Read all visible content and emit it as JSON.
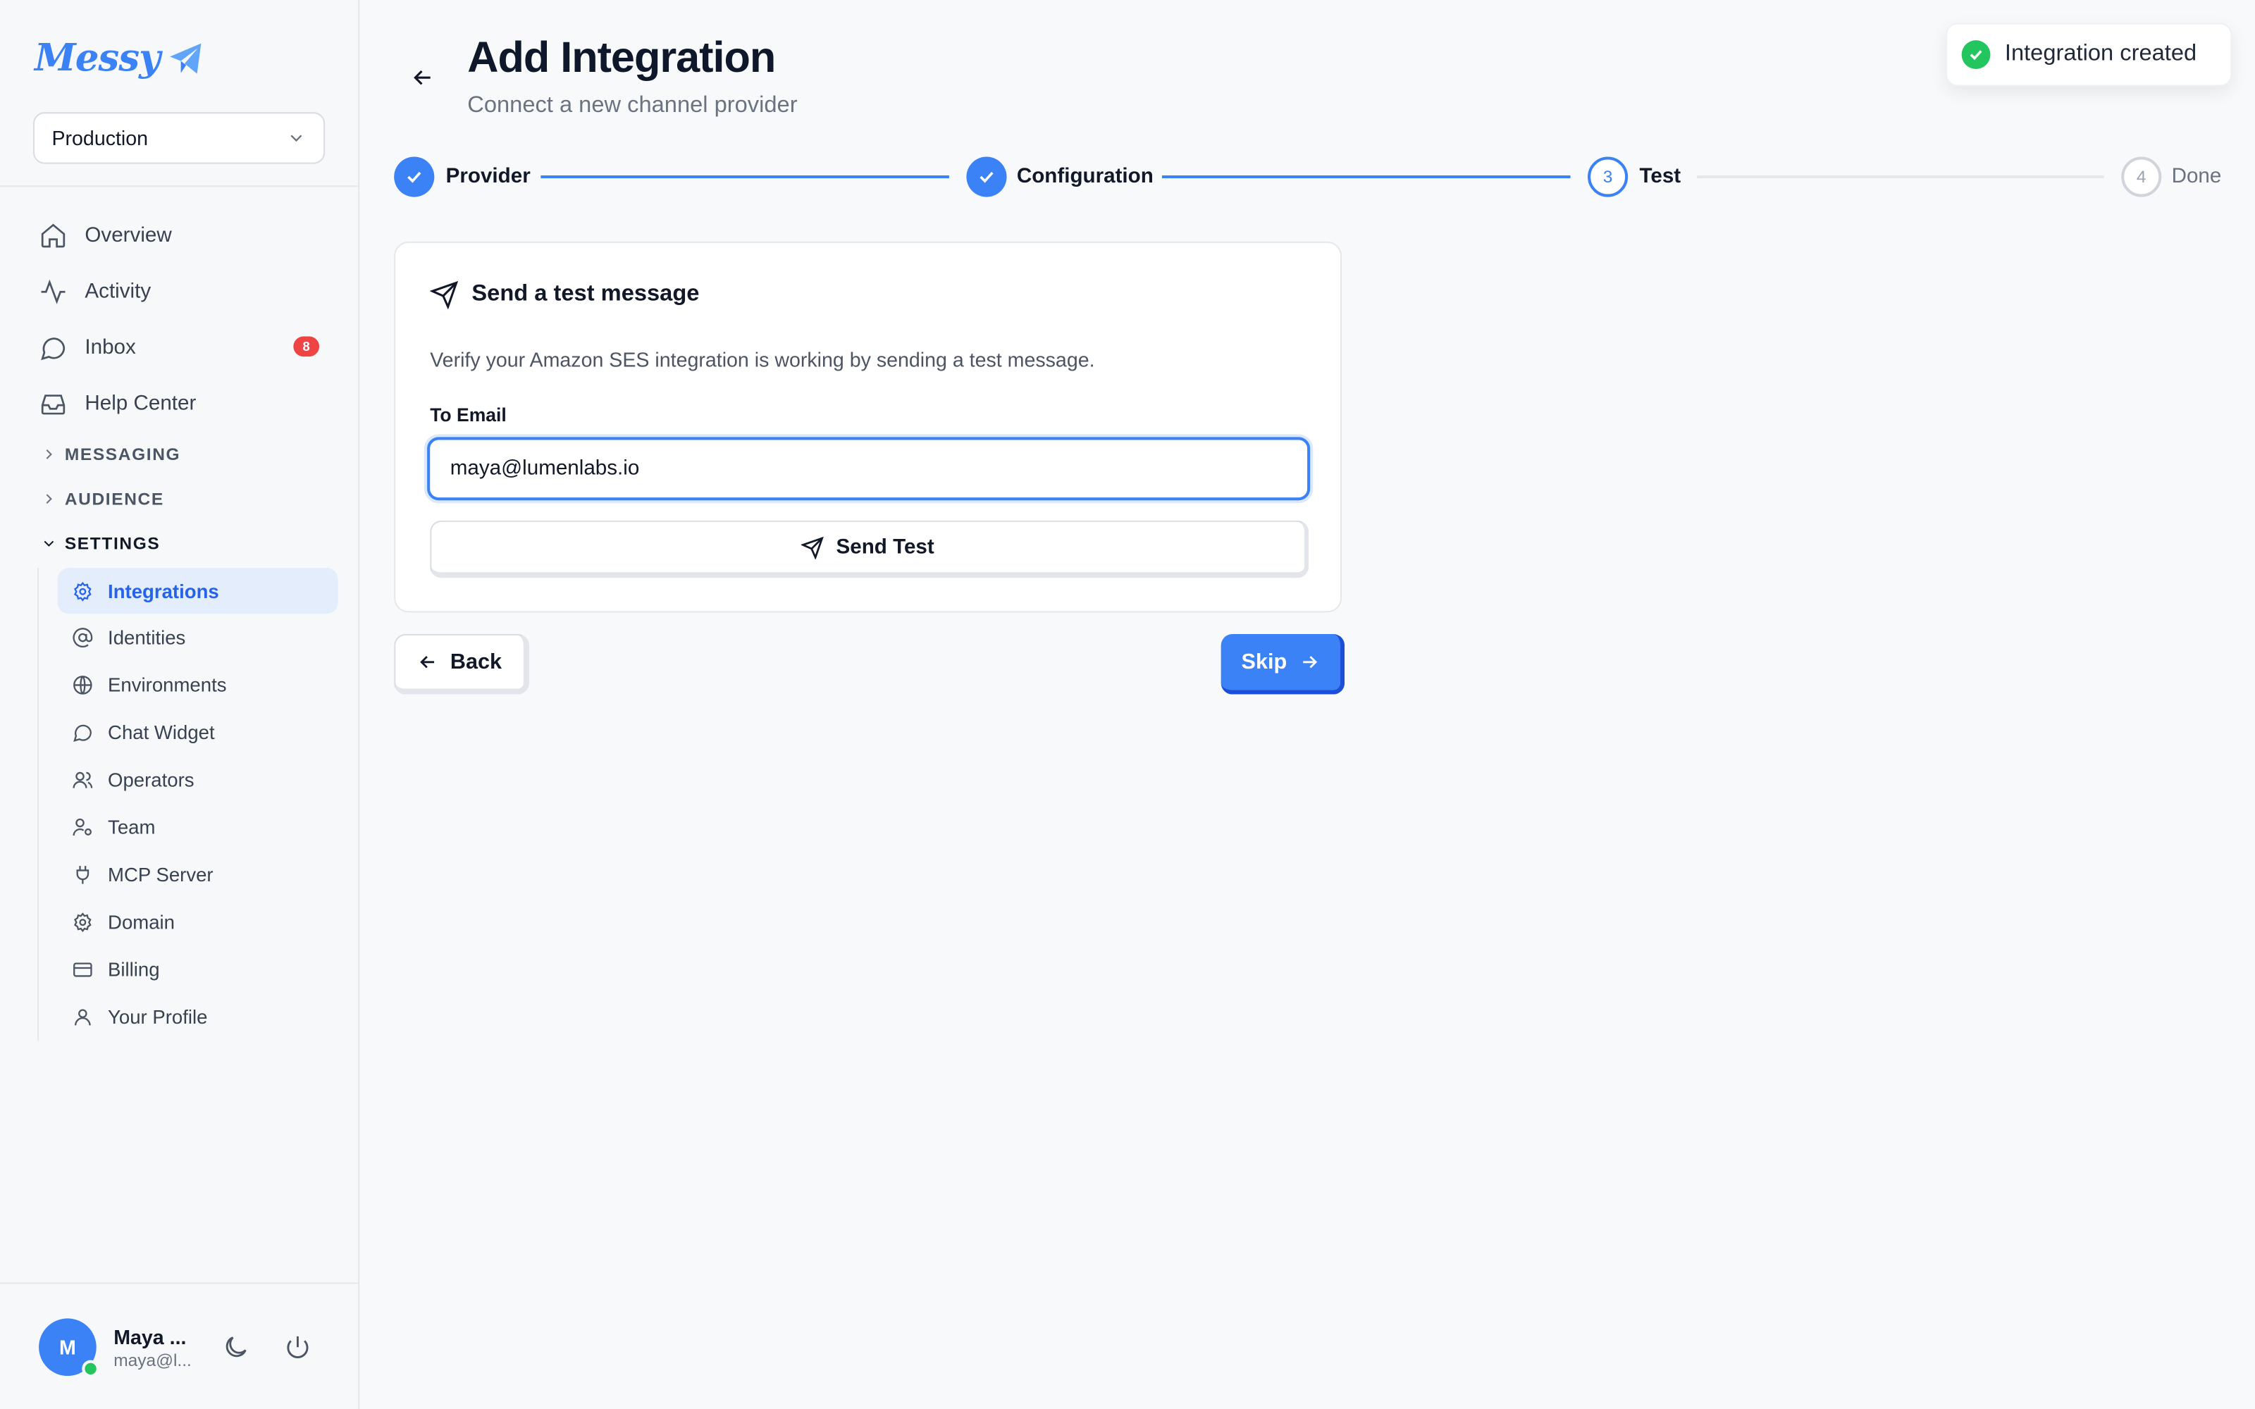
{
  "app": {
    "logo_text": "Messy"
  },
  "environment": {
    "selected": "Production"
  },
  "nav": {
    "items": [
      {
        "label": "Overview",
        "icon": "home-icon"
      },
      {
        "label": "Activity",
        "icon": "activity-icon"
      },
      {
        "label": "Inbox",
        "icon": "chat-icon",
        "badge": "8"
      },
      {
        "label": "Help Center",
        "icon": "inbox-tray-icon"
      }
    ],
    "groups": {
      "messaging": "MESSAGING",
      "audience": "AUDIENCE",
      "settings": "SETTINGS"
    },
    "settings_items": [
      {
        "label": "Integrations",
        "icon": "gear-icon",
        "active": true
      },
      {
        "label": "Identities",
        "icon": "at-sign-icon"
      },
      {
        "label": "Environments",
        "icon": "globe-icon"
      },
      {
        "label": "Chat Widget",
        "icon": "chat-bubble-icon"
      },
      {
        "label": "Operators",
        "icon": "users-icon"
      },
      {
        "label": "Team",
        "icon": "user-team-icon"
      },
      {
        "label": "MCP Server",
        "icon": "plug-icon"
      },
      {
        "label": "Domain",
        "icon": "gear-icon"
      },
      {
        "label": "Billing",
        "icon": "credit-card-icon"
      },
      {
        "label": "Your Profile",
        "icon": "user-icon"
      }
    ]
  },
  "user": {
    "initial": "M",
    "name": "Maya ...",
    "email": "maya@l..."
  },
  "header": {
    "title": "Add Integration",
    "subtitle": "Connect a new channel provider"
  },
  "toast": {
    "text": "Integration created"
  },
  "steps": [
    {
      "label": "Provider",
      "state": "done"
    },
    {
      "label": "Configuration",
      "state": "done"
    },
    {
      "number": "3",
      "label": "Test",
      "state": "current"
    },
    {
      "number": "4",
      "label": "Done",
      "state": "todo"
    }
  ],
  "card": {
    "title": "Send a test message",
    "description": "Verify your Amazon SES integration is working by sending a test message.",
    "email_label": "To Email",
    "email_value": "maya@lumenlabs.io",
    "send_label": "Send Test"
  },
  "footer": {
    "back_label": "Back",
    "skip_label": "Skip"
  },
  "colors": {
    "accent": "#3b82f6",
    "success": "#22c55e",
    "danger": "#ef4444"
  }
}
